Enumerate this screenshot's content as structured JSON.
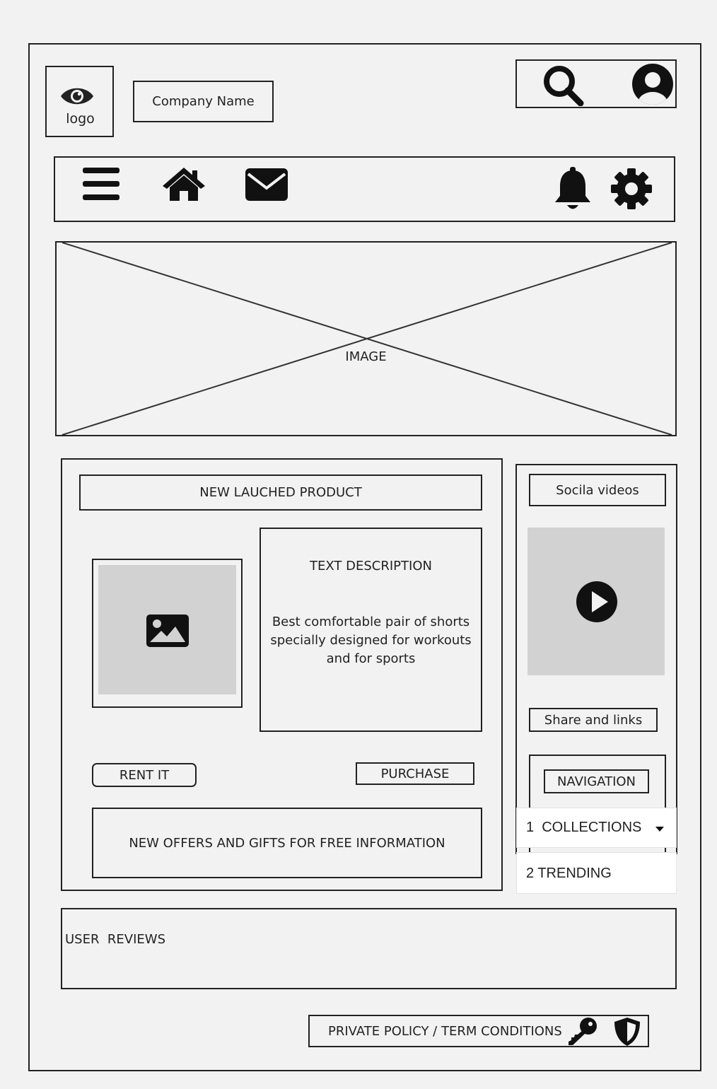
{
  "header": {
    "logo_label": "logo",
    "company_name": "Company Name"
  },
  "hero": {
    "label": "IMAGE"
  },
  "product": {
    "section_title": "NEW LAUCHED PRODUCT",
    "description_title": "TEXT DESCRIPTION",
    "description_body": "Best comfortable pair of shorts specially designed for workouts and for sports",
    "rent_label": "RENT IT",
    "purchase_label": "PURCHASE",
    "offers_label": "NEW OFFERS AND GIFTS FOR FREE INFORMATION"
  },
  "sidebar": {
    "social_videos_label": "Socila videos",
    "share_links_label": "Share and links",
    "navigation_label": "NAVIGATION",
    "nav_items": [
      {
        "label": "1  COLLECTIONS"
      },
      {
        "label": "2 TRENDING"
      }
    ]
  },
  "reviews": {
    "label": "USER  REVIEWS"
  },
  "footer": {
    "policy_label": "PRIVATE POLICY / TERM CONDITIONS"
  },
  "colors": {
    "background": "#f2f2f2",
    "stroke": "#222222",
    "placeholder": "#d2d2d2"
  }
}
